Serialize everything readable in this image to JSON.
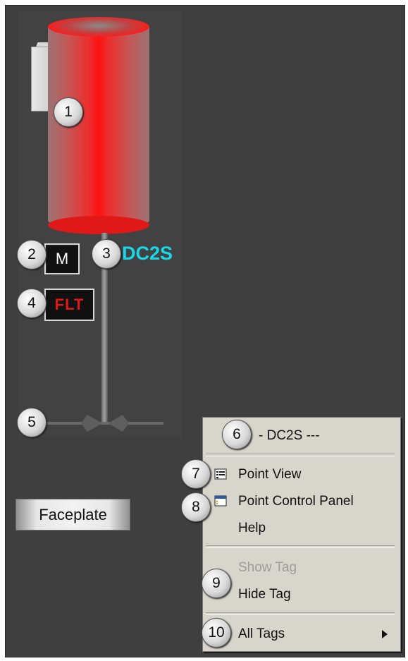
{
  "graphic": {
    "mode_text": "M",
    "fault_text": "FLT",
    "tag_name": "DC2S"
  },
  "faceplate": {
    "label": "Faceplate"
  },
  "context_menu": {
    "header": "- DC2S ---",
    "items": {
      "point_view": "Point View",
      "point_control_panel": "Point Control Panel",
      "help": "Help",
      "show_tag": "Show Tag",
      "hide_tag": "Hide Tag",
      "all_tags": "All Tags"
    }
  },
  "callouts": {
    "c1": "1",
    "c2": "2",
    "c3": "3",
    "c4": "4",
    "c5": "5",
    "c6": "6",
    "c7": "7",
    "c8": "8",
    "c9": "9",
    "c10": "10"
  },
  "colors": {
    "background": "#3f3f3f",
    "tank_red": "#ff1010",
    "tag_cyan": "#19d9e8",
    "fault_red": "#e31616",
    "menu_bg": "#d8d5cd"
  }
}
